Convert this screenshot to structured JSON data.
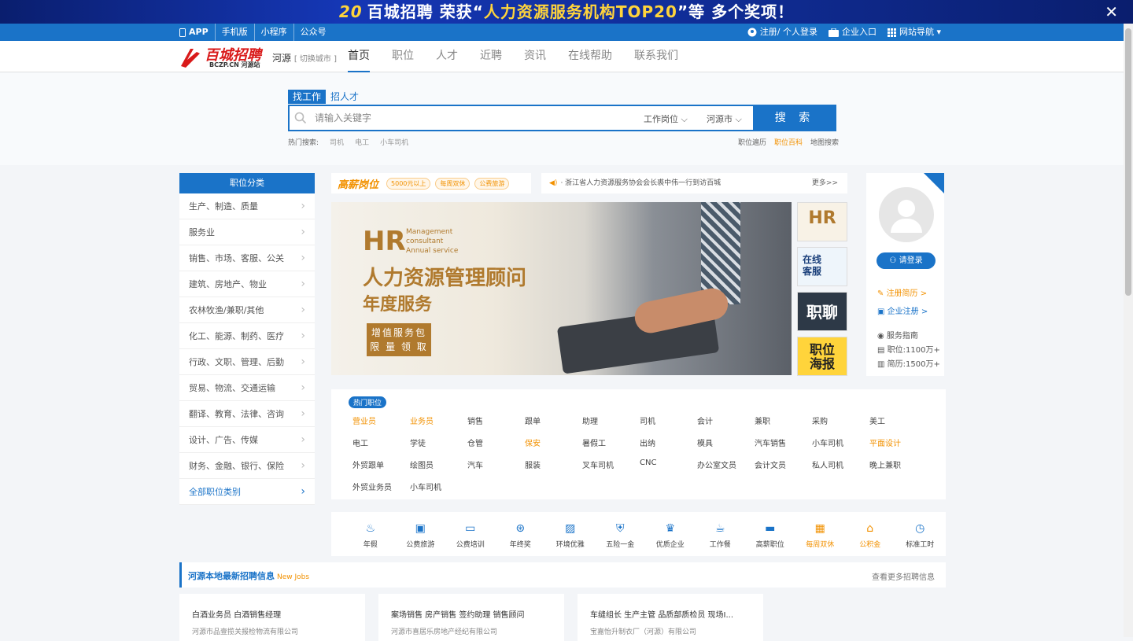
{
  "top_banner": {
    "pre": "百城招聘 荣获“",
    "hl": "人力资源服务机构TOP20",
    "post": "”等 多个奖项！",
    "badge": "20"
  },
  "topbar": {
    "app": "APP",
    "mobile": "手机版",
    "mini": "小程序",
    "official": "公众号",
    "register": "注册/ 个人登录",
    "company": "企业入口",
    "sitenav": "网站导航"
  },
  "logo": {
    "title": "百城招聘",
    "sub": "BCZP.CN 河源站"
  },
  "city": {
    "name": "河源",
    "switch": "[ 切换城市 ]"
  },
  "nav": [
    "首页",
    "职位",
    "人才",
    "近聘",
    "资讯",
    "在线帮助",
    "联系我们"
  ],
  "search": {
    "tab_find": "找工作",
    "tab_recruit": "招人才",
    "placeholder": "请输入关键字",
    "sel_type": "工作岗位",
    "sel_city": "河源市",
    "button": "搜 索",
    "hot_label": "热门搜索:",
    "hot": [
      "司机",
      "电工",
      "小车司机"
    ],
    "links": [
      "职位遍历",
      "职位百科",
      "地图搜索"
    ]
  },
  "categories": {
    "head": "职位分类",
    "items": [
      "生产、制造、质量",
      "服务业",
      "销售、市场、客服、公关",
      "建筑、房地产、物业",
      "农林牧渔/兼职/其他",
      "化工、能源、制药、医疗",
      "行政、文职、管理、后勤",
      "贸易、物流、交通运输",
      "翻译、教育、法律、咨询",
      "设计、广告、传媒",
      "财务、金融、银行、保险",
      "全部职位类别"
    ]
  },
  "gaoxin": {
    "logo": "高薪岗位",
    "tags": [
      "5000元以上",
      "每周双休",
      "公费旅游"
    ]
  },
  "notice": {
    "text": "· 浙江省人力资源服务协会会长裘中伟一行到访百城",
    "more": "更多>>"
  },
  "banner": {
    "hr": "HR",
    "mc1": "Management",
    "mc2": "consultant",
    "mc3": "Annual service",
    "t1": "人力资源管理顾问",
    "t2": "年度服务",
    "box1": "增值服务包",
    "box2": "限 量 领 取"
  },
  "side_ads": {
    "hr": "HR",
    "kefu1": "在线",
    "kefu2": "客服",
    "zhiliao": "职聊",
    "poster1": "职位",
    "poster2": "海报"
  },
  "user": {
    "login": "请登录",
    "reg_resume": "注册简历 >",
    "reg_company": "企业注册 >",
    "guide": "服务指南",
    "jobs": "职位:1100万+",
    "resumes": "简历:1500万+"
  },
  "hotjobs": {
    "label": "热门职位",
    "items": [
      "营业员",
      "业务员",
      "销售",
      "跟单",
      "助理",
      "司机",
      "会计",
      "兼职",
      "采购",
      "美工",
      "电工",
      "学徒",
      "仓管",
      "保安",
      "暑假工",
      "出纳",
      "模具",
      "汽车销售",
      "小车司机",
      "平面设计",
      "外贸跟单",
      "绘图员",
      "汽车",
      "服装",
      "叉车司机",
      "CNC",
      "办公室文员",
      "会计文员",
      "私人司机",
      "晚上兼职",
      "外贸业务员",
      "小车司机"
    ],
    "orange": [
      0,
      1,
      13,
      19
    ]
  },
  "benefits": [
    {
      "label": "年假",
      "icon": "palm-icon"
    },
    {
      "label": "公费旅游",
      "icon": "bus-icon"
    },
    {
      "label": "公费培训",
      "icon": "training-icon"
    },
    {
      "label": "年终奖",
      "icon": "bonus-icon"
    },
    {
      "label": "环境优雅",
      "icon": "photo-icon"
    },
    {
      "label": "五险一金",
      "icon": "shield-icon"
    },
    {
      "label": "优质企业",
      "icon": "trophy-icon"
    },
    {
      "label": "工作餐",
      "icon": "coffee-icon"
    },
    {
      "label": "高薪职位",
      "icon": "card-icon"
    },
    {
      "label": "每周双休",
      "icon": "calendar-icon"
    },
    {
      "label": "公积金",
      "icon": "house-icon"
    },
    {
      "label": "标准工时",
      "icon": "clock-icon"
    }
  ],
  "latest": {
    "title": "河源本地最新招聘信息",
    "en": "New Jobs",
    "more": "查看更多招聘信息"
  },
  "cards": [
    {
      "jobs": "白酒业务员  白酒销售经理",
      "company": "河源市品壹揽关报检物流有限公司"
    },
    {
      "jobs": "案场销售  房产销售  签约助理  销售顾问",
      "company": "河源市喜居乐房地产经纪有限公司"
    },
    {
      "jobs": "车缝组长  生产主管  品质部质检员  现场I...",
      "company": "宝嘉怡升制衣厂（河源）有限公司"
    }
  ]
}
